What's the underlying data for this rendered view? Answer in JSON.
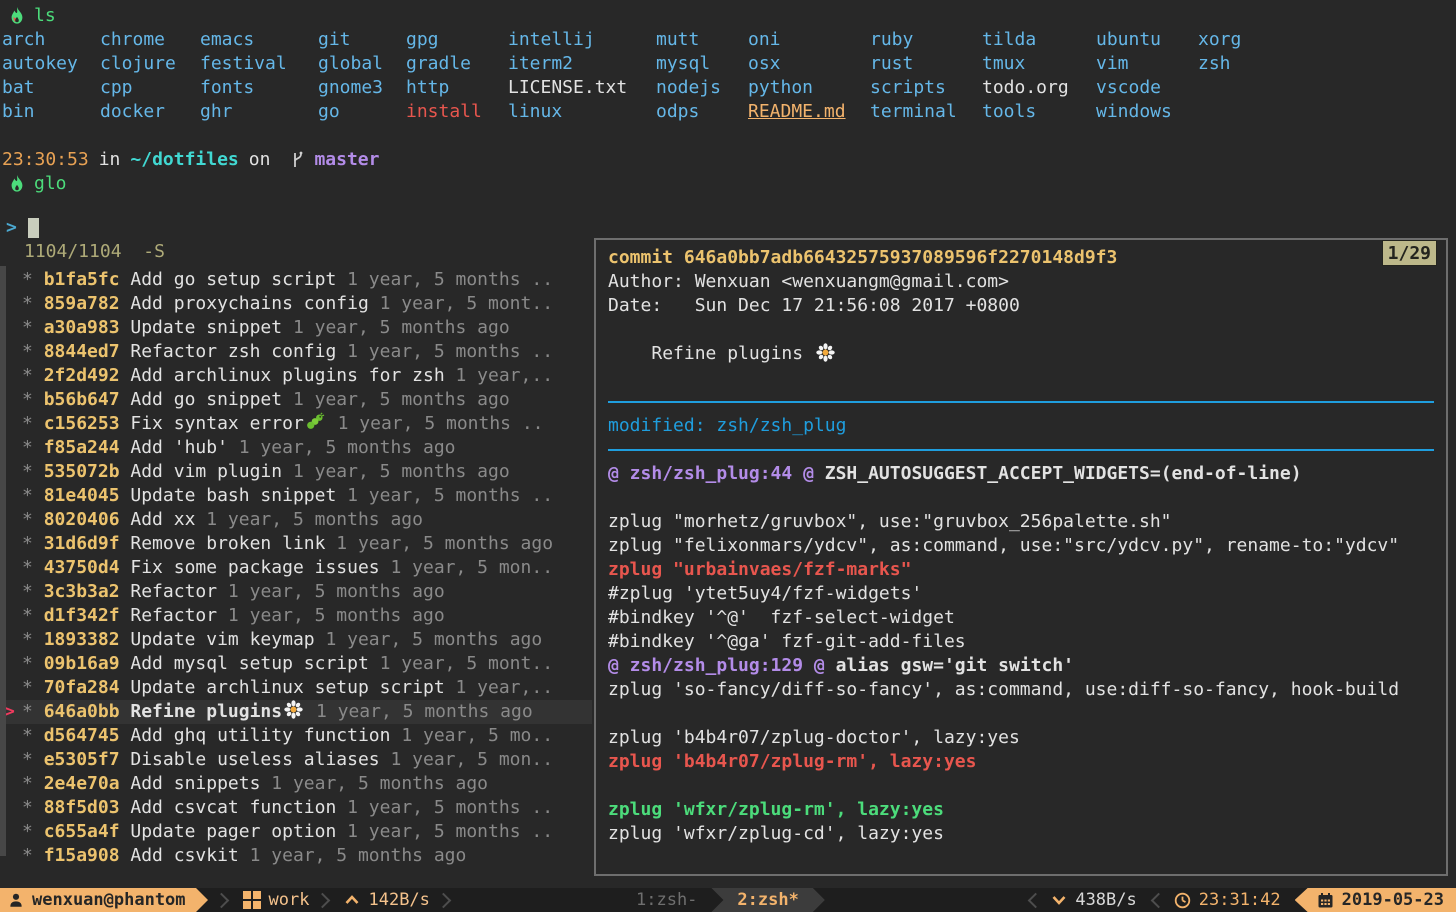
{
  "shell": {
    "ls_command": "ls",
    "glo_command": "glo",
    "ls_columns": [
      [
        "arch",
        "autokey",
        "bat",
        "bin"
      ],
      [
        "chrome",
        "clojure",
        "cpp",
        "docker"
      ],
      [
        "emacs",
        "festival",
        "fonts",
        "ghr"
      ],
      [
        "git",
        "global",
        "gnome3",
        "go"
      ],
      [
        "gpg",
        "gradle",
        "http",
        {
          "t": "install",
          "s": "red"
        }
      ],
      [
        "intellij",
        "iterm2",
        {
          "t": "LICENSE.txt",
          "s": "plain"
        },
        "linux"
      ],
      [
        "mutt",
        "mysql",
        "nodejs",
        "odps"
      ],
      [
        "oni",
        "osx",
        "python",
        {
          "t": "README.md",
          "s": "readme"
        }
      ],
      [
        "ruby",
        "rust",
        "scripts",
        "terminal"
      ],
      [
        "tilda",
        "tmux",
        {
          "t": "todo.org",
          "s": "plain"
        },
        "tools"
      ],
      [
        "ubuntu",
        "vim",
        "vscode",
        "windows"
      ],
      [
        "xorg",
        "zsh"
      ]
    ],
    "prompt": {
      "time": "23:30:53",
      "in_word": "in",
      "path": "~/dotfiles",
      "on_word": "on",
      "branch": "master"
    }
  },
  "fzf": {
    "prompt_char": ">",
    "counter": "1104/1104",
    "flags": "-S",
    "rows": [
      {
        "hash": "b1fa5fc",
        "message": "Add go setup script",
        "date": "1 year, 5 months .."
      },
      {
        "hash": "859a782",
        "message": "Add proxychains config",
        "date": "1 year, 5 mont.."
      },
      {
        "hash": "a30a983",
        "message": "Update snippet",
        "date": "1 year, 5 months ago"
      },
      {
        "hash": "8844ed7",
        "message": "Refactor zsh config",
        "date": "1 year, 5 months .."
      },
      {
        "hash": "2f2d492",
        "message": "Add archlinux plugins for zsh",
        "date": "1 year,.."
      },
      {
        "hash": "b56b647",
        "message": "Add go snippet",
        "date": "1 year, 5 months ago"
      },
      {
        "hash": "c156253",
        "message": "Fix syntax error",
        "emoji": "bug",
        "date": "1 year, 5 months .."
      },
      {
        "hash": "f85a244",
        "message": "Add 'hub'",
        "date": "1 year, 5 months ago"
      },
      {
        "hash": "535072b",
        "message": "Add vim plugin",
        "date": "1 year, 5 months ago"
      },
      {
        "hash": "81e4045",
        "message": "Update bash snippet",
        "date": "1 year, 5 months .."
      },
      {
        "hash": "8020406",
        "message": "Add xx",
        "date": "1 year, 5 months ago"
      },
      {
        "hash": "31d6d9f",
        "message": "Remove broken link",
        "date": "1 year, 5 months ago"
      },
      {
        "hash": "43750d4",
        "message": "Fix some package issues",
        "date": "1 year, 5 mon.."
      },
      {
        "hash": "3c3b3a2",
        "message": "Refactor",
        "date": "1 year, 5 months ago"
      },
      {
        "hash": "d1f342f",
        "message": "Refactor",
        "date": "1 year, 5 months ago"
      },
      {
        "hash": "1893382",
        "message": "Update vim keymap",
        "date": "1 year, 5 months ago"
      },
      {
        "hash": "09b16a9",
        "message": "Add mysql setup script",
        "date": "1 year, 5 mont.."
      },
      {
        "hash": "70fa284",
        "message": "Update archlinux setup script",
        "date": "1 year,.."
      },
      {
        "hash": "646a0bb",
        "message": "Refine plugins",
        "emoji": "flower",
        "date": "1 year, 5 months ago",
        "selected": true
      },
      {
        "hash": "d564745",
        "message": "Add ghq utility function",
        "date": "1 year, 5 mo.."
      },
      {
        "hash": "e5305f7",
        "message": "Disable useless aliases",
        "date": "1 year, 5 mon.."
      },
      {
        "hash": "2e4e70a",
        "message": "Add snippets",
        "date": "1 year, 5 months ago"
      },
      {
        "hash": "88f5d03",
        "message": "Add csvcat function",
        "date": "1 year, 5 months .."
      },
      {
        "hash": "c655a4f",
        "message": "Update pager option",
        "date": "1 year, 5 months .."
      },
      {
        "hash": "f15a908",
        "message": "Add csvkit",
        "date": "1 year, 5 months ago"
      }
    ]
  },
  "preview": {
    "badge": "1/29",
    "commit_line": "commit 646a0bb7adb66432575937089596f2270148d9f3",
    "author_line": "Author: Wenxuan <wenxuangm@gmail.com>",
    "date_line": "Date:   Sun Dec 17 21:56:08 2017 +0800",
    "message_indent": "    ",
    "message": "Refine plugins",
    "modified_line": "modified: zsh/zsh_plug",
    "diff_lines": [
      {
        "type": "hunk",
        "prefix": "@ zsh/zsh_plug:44 @",
        "text": " ZSH_AUTOSUGGEST_ACCEPT_WIDGETS=(end-of-line)"
      },
      {
        "type": "blank",
        "text": ""
      },
      {
        "type": "ctx",
        "text": "zplug \"morhetz/gruvbox\", use:\"gruvbox_256palette.sh\""
      },
      {
        "type": "ctx",
        "text": "zplug \"felixonmars/ydcv\", as:command, use:\"src/ydcv.py\", rename-to:\"ydcv\""
      },
      {
        "type": "del",
        "text": "zplug \"urbainvaes/fzf-marks\""
      },
      {
        "type": "ctx",
        "text": "#zplug 'ytet5uy4/fzf-widgets'"
      },
      {
        "type": "ctx",
        "text": "#bindkey '^@'  fzf-select-widget"
      },
      {
        "type": "ctx",
        "text": "#bindkey '^@ga' fzf-git-add-files"
      },
      {
        "type": "hunk",
        "prefix": "@ zsh/zsh_plug:129 @",
        "text": " alias gsw='git switch'"
      },
      {
        "type": "ctx",
        "text": "zplug 'so-fancy/diff-so-fancy', as:command, use:diff-so-fancy, hook-build"
      },
      {
        "type": "blank",
        "text": ""
      },
      {
        "type": "ctx",
        "text": "zplug 'b4b4r07/zplug-doctor', lazy:yes"
      },
      {
        "type": "del",
        "text": "zplug 'b4b4r07/zplug-rm', lazy:yes"
      },
      {
        "type": "blank",
        "text": ""
      },
      {
        "type": "add",
        "text": "zplug 'wfxr/zplug-rm', lazy:yes"
      },
      {
        "type": "ctx",
        "text": "zplug 'wfxr/zplug-cd', lazy:yes"
      }
    ]
  },
  "status_bar": {
    "host": "wenxuan@phantom",
    "session": "work",
    "upload_rate": "142B/s",
    "windows": [
      {
        "label": "1:zsh-",
        "active": false
      },
      {
        "label": "2:zsh*",
        "active": true
      }
    ],
    "download_rate": "438B/s",
    "time": "23:31:42",
    "date": "2019-05-23"
  },
  "colors": {
    "background": "#282828",
    "accent_orange": "#f3b36c",
    "hash_yellow": "#ecc36e",
    "diff_rule_blue": "#1f9ede",
    "removed_red": "#e8564e",
    "added_green": "#4cdc7b",
    "branch_purple": "#b38ce8",
    "pointer_red": "#f03a5e"
  }
}
